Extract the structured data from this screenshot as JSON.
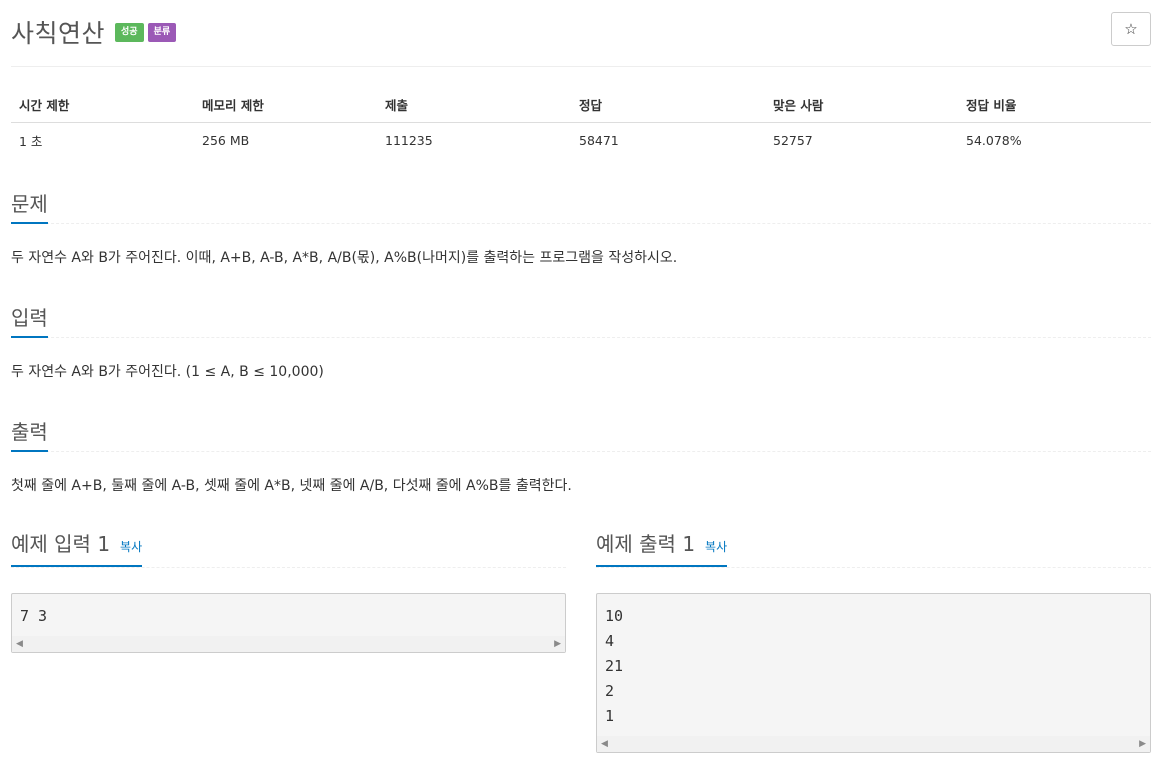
{
  "problem": {
    "title": "사칙연산",
    "badges": {
      "success": "성공",
      "tag": "분류"
    },
    "star_icon": "☆"
  },
  "info_table": {
    "headers": [
      "시간 제한",
      "메모리 제한",
      "제출",
      "정답",
      "맞은 사람",
      "정답 비율"
    ],
    "values": [
      "1 초",
      "256 MB",
      "111235",
      "58471",
      "52757",
      "54.078%"
    ]
  },
  "sections": {
    "description": {
      "title": "문제",
      "text": "두 자연수 A와 B가 주어진다. 이때, A+B, A-B, A*B, A/B(몫), A%B(나머지)를 출력하는 프로그램을 작성하시오."
    },
    "input": {
      "title": "입력",
      "text": "두 자연수 A와 B가 주어진다. (1 ≤ A, B ≤ 10,000)"
    },
    "output": {
      "title": "출력",
      "text": "첫째 줄에 A+B, 둘째 줄에 A-B, 셋째 줄에 A*B, 넷째 줄에 A/B, 다섯째 줄에 A%B를 출력한다."
    }
  },
  "samples": {
    "input": {
      "title": "예제 입력 1",
      "copy_label": "복사",
      "lines": [
        "7 3"
      ]
    },
    "output": {
      "title": "예제 출력 1",
      "copy_label": "복사",
      "lines": [
        "10",
        "4",
        "21",
        "2",
        "1"
      ]
    },
    "scroll_left": "◀",
    "scroll_right": "▶"
  }
}
